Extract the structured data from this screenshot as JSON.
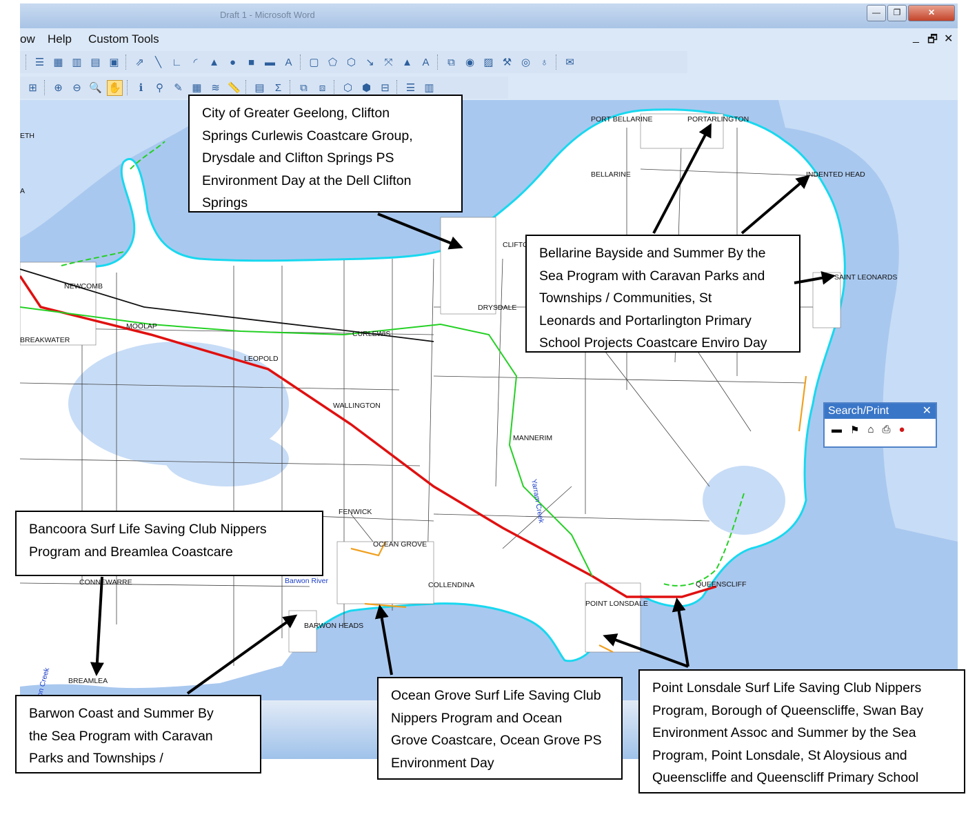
{
  "window": {
    "title": "Draft 1 - Microsoft Word",
    "minimize_symbol": "—",
    "restore_symbol": "❐",
    "close_symbol": "✕"
  },
  "menubar": {
    "items": [
      "ow",
      "Help",
      "Custom Tools"
    ],
    "mdi_minimize": "_",
    "mdi_restore": "🗗",
    "mdi_close": "✕"
  },
  "toolbar_top": {
    "icons": [
      "list-icon",
      "table-icon",
      "chart-icon",
      "grid-icon",
      "window-icon",
      "pointer-icon",
      "line-icon",
      "polyline-icon",
      "arc-icon",
      "triangle-icon",
      "circle-icon",
      "rectangle-icon",
      "rounded-rect-icon",
      "text-icon",
      "frame-icon",
      "polygon-icon",
      "reshape-icon",
      "node-icon",
      "split-icon",
      "flag-icon",
      "label-icon",
      "layers-icon",
      "globe-icon",
      "map-icon",
      "tool-icon",
      "settings-icon",
      "globe-marker-icon",
      "message-icon"
    ],
    "glyphs": [
      "☰",
      "▦",
      "▥",
      "▤",
      "▣",
      "⇗",
      "╲",
      "∟",
      "◜",
      "▲",
      "●",
      "■",
      "▬",
      "A",
      "▢",
      "⬠",
      "⬡",
      "↘",
      "⤧",
      "▲",
      "A",
      "⧉",
      "◉",
      "▨",
      "⚒",
      "◎",
      "♁",
      "✉"
    ]
  },
  "toolbar_bottom": {
    "icons": [
      "select-icon",
      "zoom-in-icon",
      "zoom-out-icon",
      "zoom-query-icon",
      "pan-hand-icon",
      "info-icon",
      "measure-icon",
      "label-tag-icon",
      "layer-control-icon",
      "stack-icon",
      "ruler-icon",
      "browse-icon",
      "sum-icon",
      "redistrict-icon",
      "graph-icon",
      "thematic-icon",
      "scale-icon",
      "print-icon",
      "legend-icon",
      "report-icon"
    ],
    "glyphs": [
      "⊞",
      "⊕",
      "⊖",
      "🔍",
      "✋",
      "ℹ",
      "⚲",
      "✎",
      "▦",
      "≋",
      "📏",
      "▤",
      "Σ",
      "⧉",
      "⧈",
      "⬡",
      "⬢",
      "⊟",
      "☰",
      "▥"
    ]
  },
  "map_labels": [
    "PORT BELLARINE",
    "PORTARLINGTON",
    "BELLARINE",
    "INDENTED HEAD",
    "CLIFTON S",
    "DRYSDALE",
    "SAINT LEONARDS",
    "NEWCOMB",
    "MOOLAP",
    "BREAKWATER",
    "CURLEWIS",
    "LEOPOLD",
    "WALLINGTON",
    "MANNERIM",
    "Yarram Creek",
    "FENWICK",
    "OCEAN GROVE",
    "COLLENDINA",
    "QUEENSCLIFF",
    "POINT LONSDALE",
    "BARWON HEADS",
    "Barwon River",
    "CONNEWARRE",
    "BREAMLEA",
    "ETH",
    "A",
    "son Creek"
  ],
  "callouts": {
    "geelong": [
      "City of Greater Geelong, Clifton",
      "Springs Curlewis Coastcare Group,",
      "Drysdale and Clifton Springs PS",
      "Environment Day at the Dell Clifton",
      "Springs"
    ],
    "bellarine": [
      "Bellarine Bayside and Summer By the",
      "Sea Program with Caravan Parks and",
      "Townships / Communities, St",
      "Leonards and Portarlington Primary",
      "School Projects Coastcare Enviro Day"
    ],
    "bancoora": [
      "Bancoora Surf Life Saving Club Nippers",
      "Program and Breamlea Coastcare"
    ],
    "barwon": [
      "Barwon Coast and Summer By",
      "the Sea Program with Caravan",
      "Parks and Townships /"
    ],
    "ocean_grove": [
      "Ocean Grove Surf Life Saving Club",
      "Nippers Program and Ocean",
      "Grove Coastcare, Ocean Grove PS",
      "Environment Day"
    ],
    "point_lonsdale": [
      "Point Lonsdale Surf Life Saving Club Nippers",
      "Program, Borough of Queenscliffe, Swan Bay",
      "Environment Assoc and Summer by the Sea",
      "Program, Point Lonsdale, St Aloysious and",
      "Queenscliffe and Queenscliff Primary School"
    ]
  },
  "search_print": {
    "title": "Search/Print",
    "close": "✕",
    "glyphs": [
      "▬",
      "⚑",
      "⌂",
      "⎙",
      "●"
    ]
  },
  "colors": {
    "water": "#a9c8ef",
    "deep_water": "#c7dcf6",
    "land": "#ffffff",
    "coastline": "#18d8ef",
    "highway": "#e01010",
    "road_green": "#24d024",
    "road_black": "#111111",
    "track_orange": "#f0a020"
  }
}
